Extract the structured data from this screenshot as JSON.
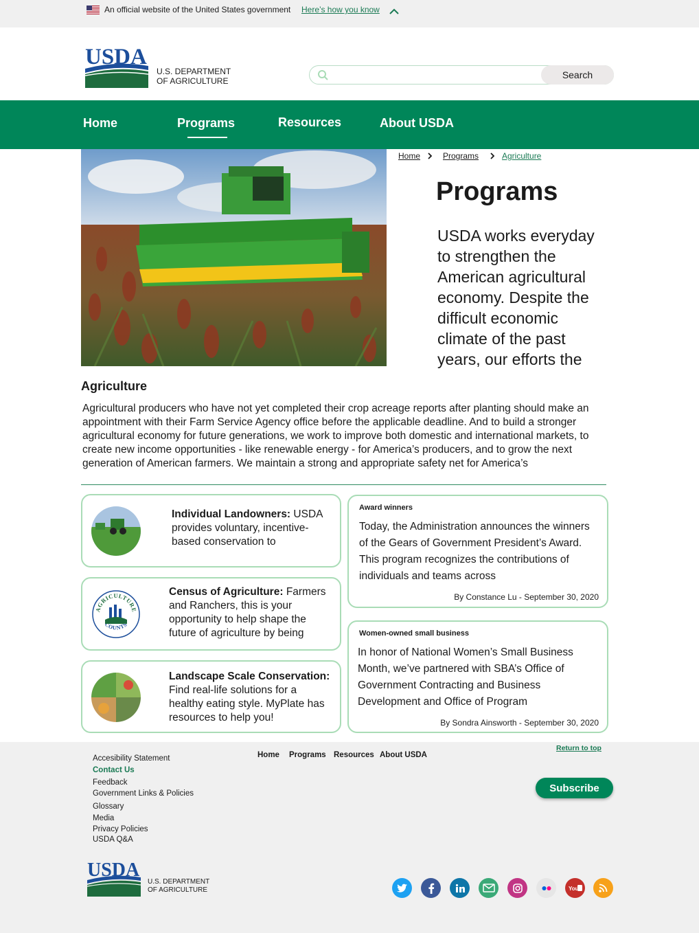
{
  "gov_banner": {
    "text": "An official website of the United States government",
    "link": "Here’s how you know"
  },
  "header": {
    "logo_word": "USDA",
    "dept_line1": "U.S. DEPARTMENT",
    "dept_line2": "OF AGRICULTURE",
    "search_placeholder": "",
    "search_button": "Search"
  },
  "nav": {
    "items": [
      "Home",
      "Programs",
      "Resources",
      "About USDA"
    ],
    "active": "Programs"
  },
  "breadcrumb": [
    "Home",
    "Programs",
    "Agriculture"
  ],
  "hero": {
    "title": "Programs",
    "intro": "USDA works everyday to strengthen the American agricultural economy. Despite the difficult economic climate of the past years, our efforts the"
  },
  "section": {
    "heading": "Agriculture",
    "body": "Agricultural producers who have not yet completed their crop acreage reports after planting should make an appointment with their Farm Service Agency office before the applicable deadline. And to build a stronger agricultural economy for future generations, we work to improve both domestic and international markets, to create new income opportunities - like renewable energy - for America’s producers, and to grow the next generation of American farmers. We maintain a strong and appropriate safety net for America’s"
  },
  "programs": [
    {
      "title": "Individual Landowners:",
      "text": "USDA provides voluntary, incentive-based conservation to"
    },
    {
      "title": "Census of Agriculture:",
      "text": "Farmers and Ranchers, this is your opportunity to help shape the future of agriculture by being",
      "badge_top": "AGRICULTURE",
      "badge_bottom": "COUNTS"
    },
    {
      "title": "Landscape Scale Conservation:",
      "text": "Find real-life solutions for a healthy eating style. MyPlate has resources to help you!"
    }
  ],
  "news": [
    {
      "tag": "Award winners",
      "body": "Today, the Administration announces the winners of the Gears of Government President’s Award. This program recognizes the contributions of individuals and teams across",
      "byline": "By Constance Lu - September 30, 2020"
    },
    {
      "tag": "Women-owned small business",
      "body": "In honor of National Women’s Small Business Month, we’ve partnered with SBA’s Office of Government Contracting and Business Development and Office of Program",
      "byline": "By Sondra Ainsworth - September 30, 2020"
    }
  ],
  "footer": {
    "links": [
      "Accesibility Statement",
      "Contact Us",
      "Feedback",
      "Government Links & Policies",
      "Glossary",
      "Media",
      "Privacy Policies",
      "USDA Q&A"
    ],
    "nav": [
      "Home",
      "Programs",
      "Resources",
      "About USDA"
    ],
    "return_top": "Return to top",
    "subscribe": "Subscribe",
    "logo_word": "USDA",
    "dept_line1": "U.S. DEPARTMENT",
    "dept_line2": "OF AGRICULTURE",
    "social": [
      {
        "icon": "twitter-icon",
        "color": "#1da1f2"
      },
      {
        "icon": "facebook-icon",
        "color": "#3b5998"
      },
      {
        "icon": "linkedin-icon",
        "color": "#0e76a8"
      },
      {
        "icon": "email-icon",
        "color": "#3aa977"
      },
      {
        "icon": "instagram-icon",
        "color": "#c13584"
      },
      {
        "icon": "flickr-icon",
        "color": "#e6e6e6"
      },
      {
        "icon": "youtube-icon",
        "color": "#c4302b"
      },
      {
        "icon": "rss-icon",
        "color": "#f7a11a"
      }
    ]
  },
  "colors": {
    "brand_green": "#008659",
    "link_green": "#1a7a54",
    "card_border": "#a9dcb6"
  }
}
